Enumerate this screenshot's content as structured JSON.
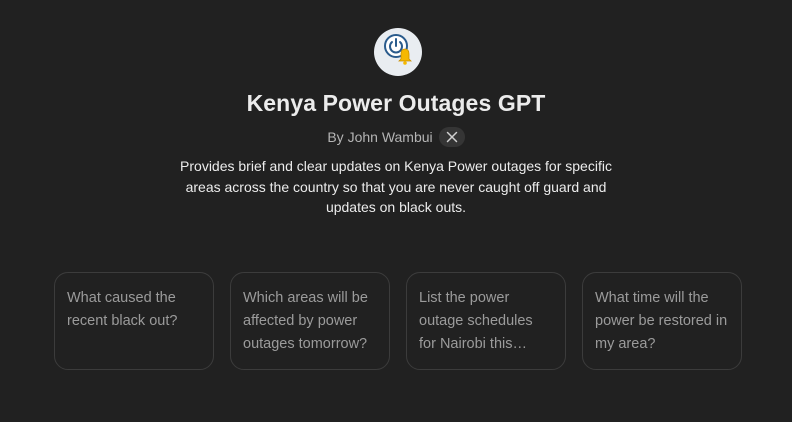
{
  "gpt": {
    "avatar_icon": "power-bell-icon",
    "title": "Kenya Power Outages GPT",
    "author": "By John Wambui",
    "social_icon": "x-logo-icon",
    "description": "Provides brief and clear updates on Kenya Power outages for specific areas across the country so that you are never caught off guard and updates on black outs."
  },
  "prompts": [
    {
      "label": "What caused the recent black out?"
    },
    {
      "label": "Which areas will be affected by power outages tomorrow?"
    },
    {
      "label": "List the power outage schedules for Nairobi this week."
    },
    {
      "label": "What time will the power be restored in my area?"
    }
  ],
  "colors": {
    "background": "#212121",
    "accent_yellow": "#f5b800",
    "icon_blue": "#2a5b8c"
  }
}
